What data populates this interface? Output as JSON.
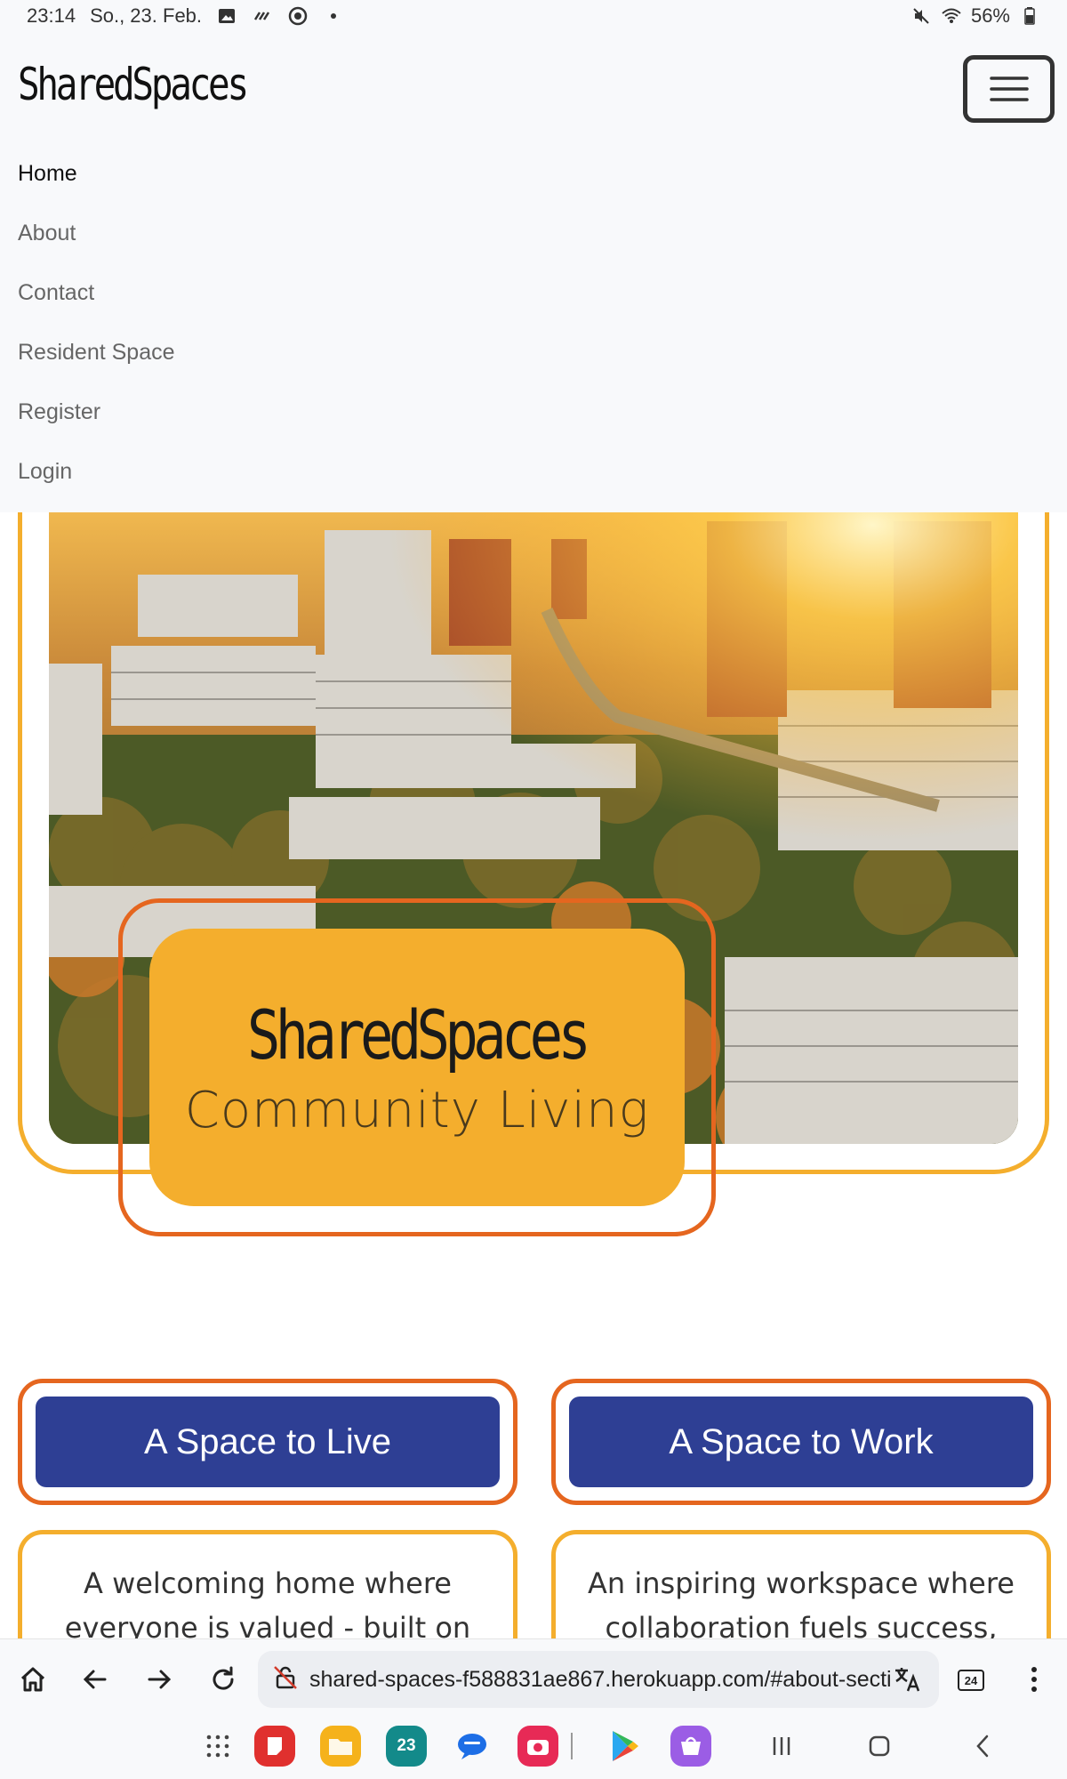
{
  "status_bar": {
    "time": "23:14",
    "date": "So., 23. Feb.",
    "battery": "56%"
  },
  "navbar": {
    "brand": "SharedSpaces",
    "items": [
      {
        "label": "Home",
        "active": true
      },
      {
        "label": "About",
        "active": false
      },
      {
        "label": "Contact",
        "active": false
      },
      {
        "label": "Resident Space",
        "active": false
      },
      {
        "label": "Register",
        "active": false
      },
      {
        "label": "Login",
        "active": false
      }
    ]
  },
  "hero": {
    "title": "SharedSpaces",
    "subtitle": "Community Living"
  },
  "features": [
    {
      "button": "A Space to Live",
      "description": "A welcoming home where everyone is valued - built on care,"
    },
    {
      "button": "A Space to Work",
      "description": "An inspiring workspace where collaboration fuels success,"
    }
  ],
  "browser": {
    "url": "shared-spaces-f588831ae867.herokuapp.com/#about-secti",
    "tab_count": "24"
  },
  "dock": {
    "calendar_day": "23"
  },
  "colors": {
    "accent_yellow": "#f4ae2d",
    "accent_orange": "#e5661f",
    "button_blue": "#2e3f94"
  }
}
